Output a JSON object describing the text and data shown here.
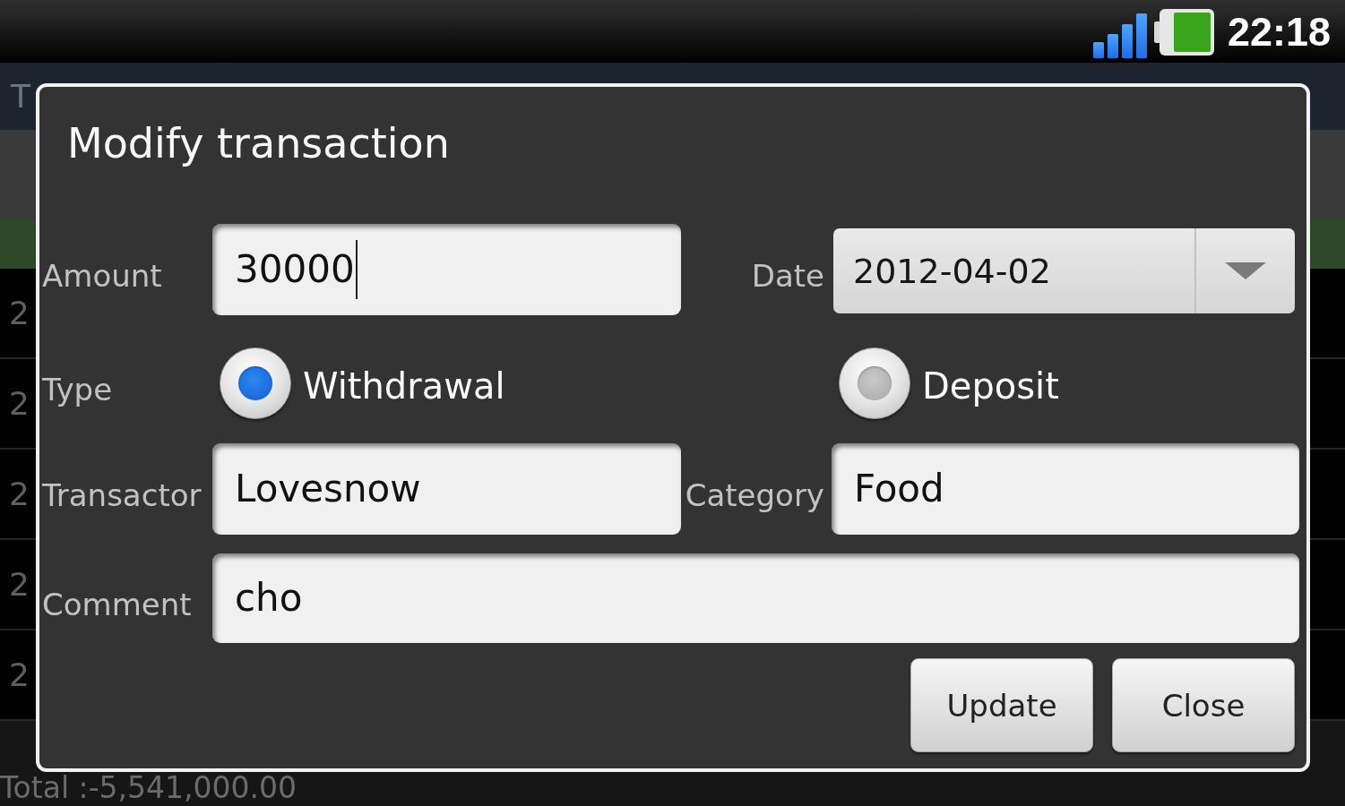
{
  "status_bar": {
    "time": "22:18"
  },
  "app": {
    "title": "T",
    "rows": [
      {
        "column_1": "2"
      },
      {
        "column_1": "2"
      },
      {
        "column_1": "2"
      },
      {
        "column_1": "2"
      },
      {
        "column_1": "2"
      }
    ],
    "total": "Total :-5,541,000.00"
  },
  "dialog": {
    "title": "Modify transaction",
    "amount": {
      "label": "Amount",
      "value": "30000",
      "focused": true
    },
    "date": {
      "label": "Date",
      "value": "2012-04-02"
    },
    "type": {
      "label": "Type",
      "options": [
        {
          "label": "Withdrawal",
          "selected": true
        },
        {
          "label": "Deposit",
          "selected": false
        }
      ]
    },
    "transactor": {
      "label": "Transactor",
      "value": "Lovesnow",
      "focused": false
    },
    "category": {
      "label": "Category",
      "value": "Food",
      "focused": false
    },
    "comment": {
      "label": "Comment",
      "value": "cho",
      "focused": false
    },
    "buttons": [
      "Update",
      "Close"
    ]
  }
}
